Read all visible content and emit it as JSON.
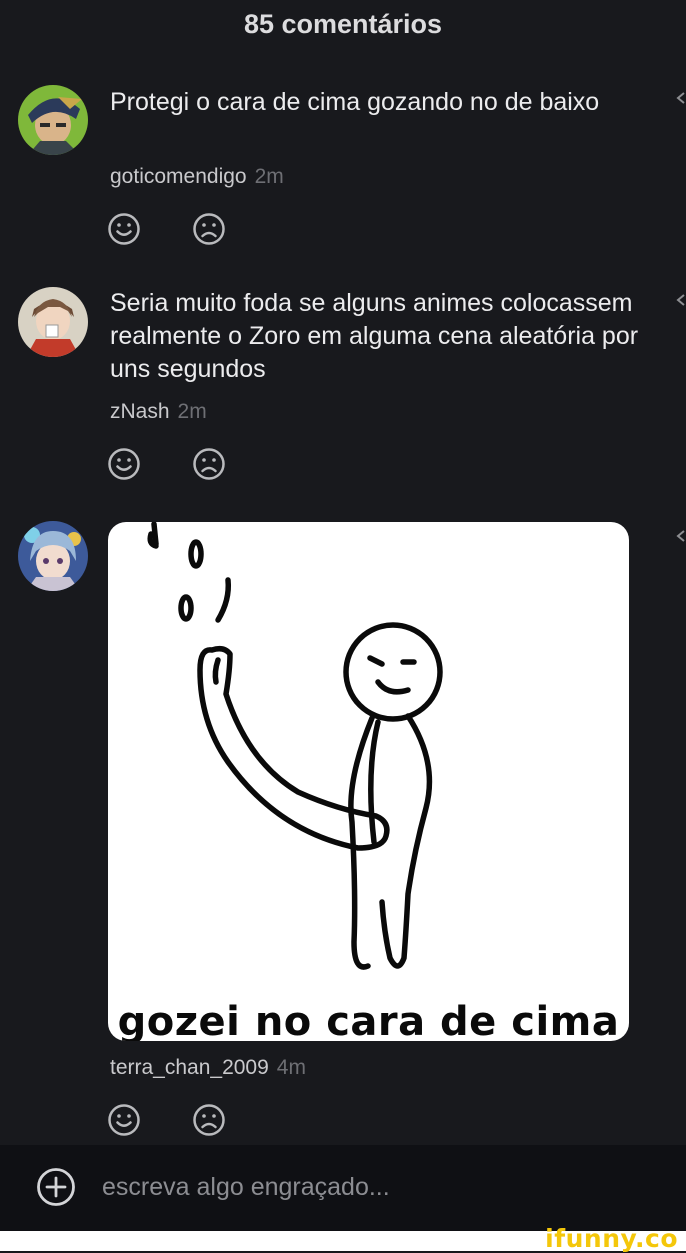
{
  "header": {
    "title": "85 comentários"
  },
  "comments": [
    {
      "text": "Protegi o cara de cima gozando no de baixo",
      "author": "goticomendigo",
      "time": "2m"
    },
    {
      "text": "Seria muito foda se alguns animes colocassem realmente o Zoro em alguma cena aleatória por uns segundos",
      "author": "zNash",
      "time": "2m"
    },
    {
      "image_caption": "gozei no cara de cima",
      "author": "terra_chan_2009",
      "time": "4m"
    }
  ],
  "composer": {
    "placeholder": "escreva algo engraçado..."
  },
  "brand": {
    "watermark": "ifunny.co"
  },
  "colors": {
    "background": "#18191d",
    "footer": "#0f1014",
    "brand": "#f4c70a",
    "time_text": "#6e6f74"
  },
  "icons": {
    "like": "smile-face-icon",
    "dislike": "frown-face-icon",
    "add": "plus-circle-icon",
    "more": "chevron-left-icon"
  }
}
